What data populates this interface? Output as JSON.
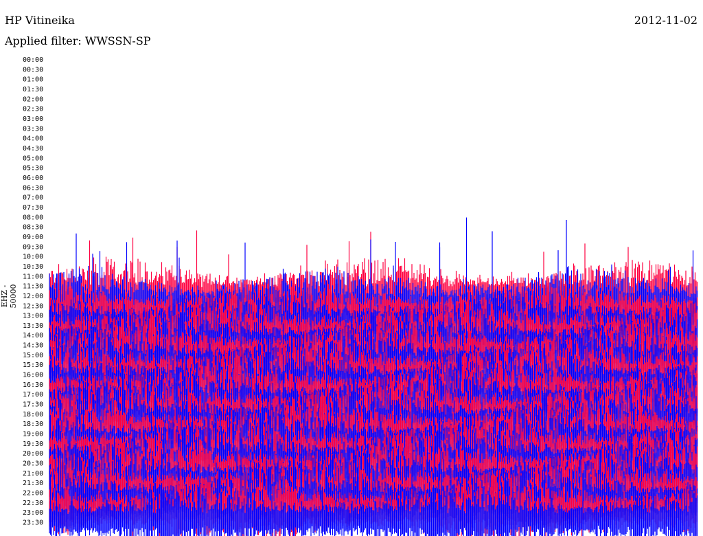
{
  "header": {
    "station": "HP Vitineika",
    "date": "2012-11-02",
    "filter": "Applied filter: WWSSN-SP"
  },
  "chart_data": {
    "type": "line",
    "subtype": "helicorder",
    "title": "HP Vitineika",
    "ylabel": "EHZ - 50000",
    "xlabel": "",
    "row_interval_minutes": 30,
    "tick_labels": [
      "00:00",
      "00:30",
      "01:00",
      "01:30",
      "02:00",
      "02:30",
      "03:00",
      "03:30",
      "04:00",
      "04:30",
      "05:00",
      "05:30",
      "06:00",
      "06:30",
      "07:00",
      "07:30",
      "08:00",
      "08:30",
      "09:00",
      "09:30",
      "10:00",
      "10:30",
      "11:00",
      "11:30",
      "12:00",
      "12:30",
      "13:00",
      "13:30",
      "14:00",
      "14:30",
      "15:00",
      "15:30",
      "16:00",
      "16:30",
      "17:00",
      "17:30",
      "18:00",
      "18:30",
      "19:00",
      "19:30",
      "20:00",
      "20:30",
      "21:00",
      "21:30",
      "22:00",
      "22:30",
      "23:00",
      "23:30"
    ],
    "first_row_with_signal": "12:00",
    "series_colors": [
      "#ff0040",
      "#0000ff"
    ],
    "grid": false
  }
}
